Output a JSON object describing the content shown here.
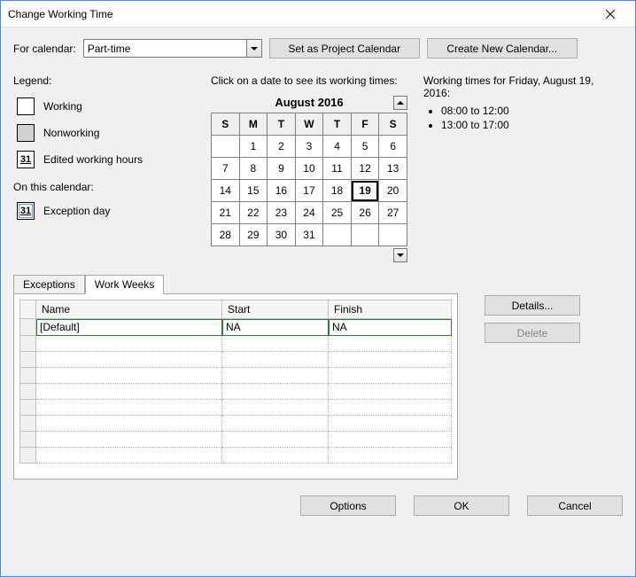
{
  "title": "Change Working Time",
  "for_calendar_label": "For calendar:",
  "calendar_selected": "Part-time",
  "btn_set_project": "Set as Project Calendar",
  "btn_create_new": "Create New Calendar...",
  "legend": {
    "title": "Legend:",
    "working": "Working",
    "nonworking": "Nonworking",
    "edited": "Edited working hours",
    "edited_num": "31",
    "on_this_calendar": "On this calendar:",
    "exception": "Exception day",
    "exception_num": "31"
  },
  "cal_prompt": "Click on a date to see its working times:",
  "cal_month": "August 2016",
  "dow": [
    "S",
    "M",
    "T",
    "W",
    "T",
    "F",
    "S"
  ],
  "weeks": [
    [
      {
        "d": "",
        "t": "blank"
      },
      {
        "d": "1",
        "t": "work"
      },
      {
        "d": "2",
        "t": "work"
      },
      {
        "d": "3",
        "t": "work"
      },
      {
        "d": "4",
        "t": "work"
      },
      {
        "d": "5",
        "t": "work"
      },
      {
        "d": "6",
        "t": "nonwork"
      }
    ],
    [
      {
        "d": "7",
        "t": "nonwork"
      },
      {
        "d": "8",
        "t": "work"
      },
      {
        "d": "9",
        "t": "work"
      },
      {
        "d": "10",
        "t": "work"
      },
      {
        "d": "11",
        "t": "work"
      },
      {
        "d": "12",
        "t": "work"
      },
      {
        "d": "13",
        "t": "nonwork"
      }
    ],
    [
      {
        "d": "14",
        "t": "nonwork"
      },
      {
        "d": "15",
        "t": "work"
      },
      {
        "d": "16",
        "t": "work"
      },
      {
        "d": "17",
        "t": "work"
      },
      {
        "d": "18",
        "t": "work"
      },
      {
        "d": "19",
        "t": "work",
        "sel": true
      },
      {
        "d": "20",
        "t": "nonwork"
      }
    ],
    [
      {
        "d": "21",
        "t": "nonwork"
      },
      {
        "d": "22",
        "t": "work"
      },
      {
        "d": "23",
        "t": "work"
      },
      {
        "d": "24",
        "t": "work"
      },
      {
        "d": "25",
        "t": "work"
      },
      {
        "d": "26",
        "t": "work"
      },
      {
        "d": "27",
        "t": "nonwork"
      }
    ],
    [
      {
        "d": "28",
        "t": "nonwork"
      },
      {
        "d": "29",
        "t": "work"
      },
      {
        "d": "30",
        "t": "work"
      },
      {
        "d": "31",
        "t": "work"
      },
      {
        "d": "",
        "t": "blank"
      },
      {
        "d": "",
        "t": "blank"
      },
      {
        "d": "",
        "t": "blank"
      }
    ]
  ],
  "working_times_header": "Working times for Friday, August 19, 2016:",
  "working_times": [
    "08:00 to 12:00",
    "13:00 to 17:00"
  ],
  "tabs": {
    "exceptions": "Exceptions",
    "workweeks": "Work Weeks"
  },
  "grid": {
    "col_name": "Name",
    "col_start": "Start",
    "col_finish": "Finish",
    "rows": [
      {
        "name": "[Default]",
        "start": "NA",
        "finish": "NA"
      }
    ]
  },
  "btn_details": "Details...",
  "btn_delete": "Delete",
  "btn_options": "Options",
  "btn_ok": "OK",
  "btn_cancel": "Cancel"
}
